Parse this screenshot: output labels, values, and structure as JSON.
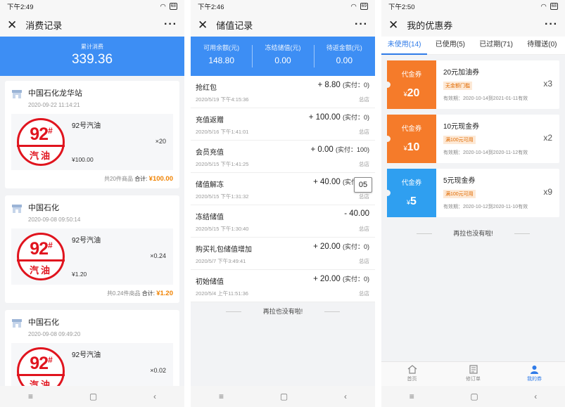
{
  "nav_icons": [
    "menu-icon",
    "home-icon",
    "back-icon"
  ],
  "p1": {
    "status_time": "下午2:49",
    "battery": "68",
    "title": "消费记录",
    "total_label": "累计消费",
    "total_value": "339.36",
    "orders": [
      {
        "store": "中国石化龙华站",
        "date": "2020-09-22 11:14:21",
        "stamp_num": "92",
        "stamp_sup": "#",
        "stamp_label": "汽油",
        "product": "92号汽油",
        "qty": "×20",
        "price": "¥100.00",
        "summary": "共20件商品",
        "total_label": "合计:",
        "total": "¥100.00"
      },
      {
        "store": "中国石化",
        "date": "2020-09-08 09:50:14",
        "stamp_num": "92",
        "stamp_sup": "#",
        "stamp_label": "汽油",
        "product": "92号汽油",
        "qty": "×0.24",
        "price": "¥1.20",
        "summary": "共0.24件商品",
        "total_label": "合计:",
        "total": "¥1.20"
      },
      {
        "store": "中国石化",
        "date": "2020-09-08 09:49:20",
        "stamp_num": "92",
        "stamp_sup": "#",
        "stamp_label": "汽油",
        "product": "92号汽油",
        "qty": "×0.02",
        "price": "",
        "summary": "",
        "total_label": "",
        "total": ""
      }
    ]
  },
  "p2": {
    "status_time": "下午2:46",
    "battery": "69",
    "title": "储值记录",
    "balances": [
      {
        "label": "可用余额(元)",
        "value": "148.80"
      },
      {
        "label": "冻结储值(元)",
        "value": "0.00"
      },
      {
        "label": "待返金额(元)",
        "value": "0.00"
      }
    ],
    "records": [
      {
        "name": "抢红包",
        "amount": "+ 8.80",
        "actual": "(实付：0)",
        "date": "2020/5/19 下午4:15:36",
        "store": "总店"
      },
      {
        "name": "充值返赠",
        "amount": "+ 100.00",
        "actual": "(实付：0)",
        "date": "2020/5/16 下午1:41:01",
        "store": "总店"
      },
      {
        "name": "会员充值",
        "amount": "+ 0.00",
        "actual": "(实付：100)",
        "date": "2020/5/15 下午1:41:25",
        "store": "总店"
      },
      {
        "name": "储值解冻",
        "amount": "+ 40.00",
        "actual": "(实付：0)",
        "date": "2020/5/15 下午1:31:32",
        "store": "总店"
      },
      {
        "name": "冻结储值",
        "amount": "- 40.00",
        "actual": "",
        "date": "2020/5/15 下午1:30:40",
        "store": "总店"
      },
      {
        "name": "购买礼包储值增加",
        "amount": "+ 20.00",
        "actual": "(实付：0)",
        "date": "2020/5/7 下午3:49:41",
        "store": "总店"
      },
      {
        "name": "初始储值",
        "amount": "+ 20.00",
        "actual": "(实付：0)",
        "date": "2020/5/4 上午11:51:36",
        "store": "总店"
      }
    ],
    "no_more": "再拉也没有啦!",
    "overlay": "05"
  },
  "p3": {
    "status_time": "下午2:50",
    "battery": "68",
    "title": "我的优惠券",
    "tabs": [
      "未使用(14)",
      "已使用(5)",
      "已过期(71)",
      "待赠送(0)"
    ],
    "coupons": [
      {
        "kind": "代金券",
        "currency": "¥",
        "value": "20",
        "name": "20元加油券",
        "tag": "无金额门槛",
        "validity": "有效期：2020-10-14到2021-01-11有效",
        "count": "x3",
        "color": "#f57b2a"
      },
      {
        "kind": "代金券",
        "currency": "¥",
        "value": "10",
        "name": "10元现金券",
        "tag": "满100元可用",
        "validity": "有效期：2020-10-14到2020-11-12有效",
        "count": "x2",
        "color": "#f57b2a"
      },
      {
        "kind": "代金券",
        "currency": "¥",
        "value": "5",
        "name": "5元现金券",
        "tag": "满100元可用",
        "validity": "有效期：2020-10-12到2020-11-10有效",
        "count": "x9",
        "color": "#2f9ff0"
      }
    ],
    "no_more": "再拉也没有啦!",
    "tabbar": [
      {
        "label": "首页",
        "icon": "home-icon"
      },
      {
        "label": "修订单",
        "icon": "order-icon"
      },
      {
        "label": "我的券",
        "icon": "user-icon"
      }
    ]
  }
}
